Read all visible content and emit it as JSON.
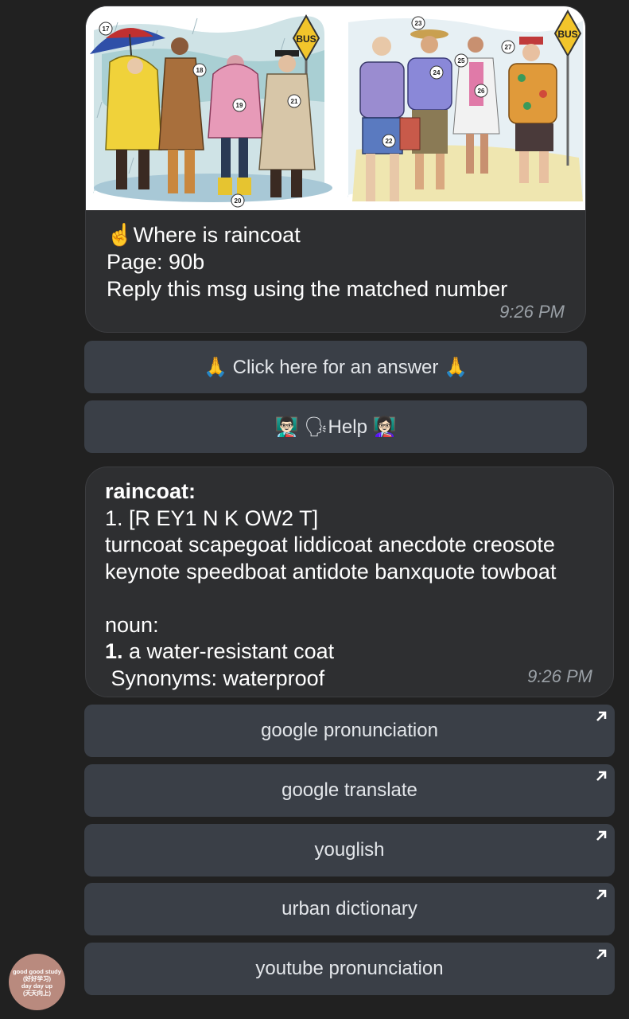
{
  "message1": {
    "illustration": {
      "sign_text": "BUS",
      "numbers": [
        "17",
        "18",
        "19",
        "20",
        "21",
        "22",
        "23",
        "24",
        "25",
        "26",
        "27"
      ]
    },
    "line1": "☝️Where is raincoat",
    "line2": "Page: 90b",
    "line3": "Reply this msg using the matched number",
    "time": "9:26 PM"
  },
  "buttons_top": [
    {
      "label": "🙏 Click here for an answer 🙏"
    },
    {
      "label": "👨🏻‍🏫 🗣Help 👩🏻‍🏫"
    }
  ],
  "message2": {
    "word": "raincoat:",
    "pronunciation": "1. [R EY1 N K OW2 T]",
    "rhymes_line1": "turncoat scapegoat liddicoat anecdote creosote",
    "rhymes_line2": "keynote speedboat antidote banxquote towboat",
    "pos": "noun:",
    "def_number": "1.",
    "definition": " a water-resistant coat",
    "synonyms": " Synonyms: waterproof",
    "time": "9:26 PM"
  },
  "link_buttons": [
    {
      "label": "google pronunciation"
    },
    {
      "label": "google translate"
    },
    {
      "label": "youglish"
    },
    {
      "label": "urban dictionary"
    },
    {
      "label": "youtube pronunciation"
    }
  ],
  "avatar": {
    "line1": "good good study",
    "line2": "(好好学习)",
    "line3": "day day up",
    "line4": "(天天向上)"
  },
  "colors": {
    "background": "#212121",
    "bubble": "#2e2f31",
    "button": "#3a3f47",
    "time": "#9aa0a6",
    "avatar": "#b98a7e"
  }
}
